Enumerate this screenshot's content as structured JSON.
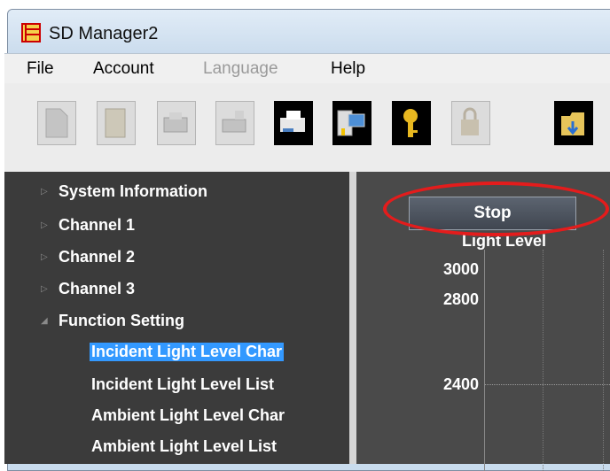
{
  "window": {
    "title": "SD Manager2"
  },
  "menu": {
    "file": "File",
    "account": "Account",
    "language": "Language",
    "help": "Help"
  },
  "tree": {
    "system_info": "System Information",
    "channel1": "Channel 1",
    "channel2": "Channel 2",
    "channel3": "Channel 3",
    "function_setting": "Function Setting",
    "children": [
      "Incident Light Level Char",
      "Incident Light Level List",
      "Ambient Light Level Char",
      "Ambient Light Level List"
    ]
  },
  "chart": {
    "stop_label": "Stop",
    "y_axis_label": "Light Level",
    "ticks": [
      "3000",
      "2800",
      "2400"
    ]
  },
  "toolbar_icons": [
    "new-document-icon",
    "open-book-icon",
    "printer-gray-icon",
    "scanner-gray-icon",
    "fax-icon",
    "network-computer-icon",
    "key-icon",
    "lock-icon",
    "folder-download-icon"
  ]
}
